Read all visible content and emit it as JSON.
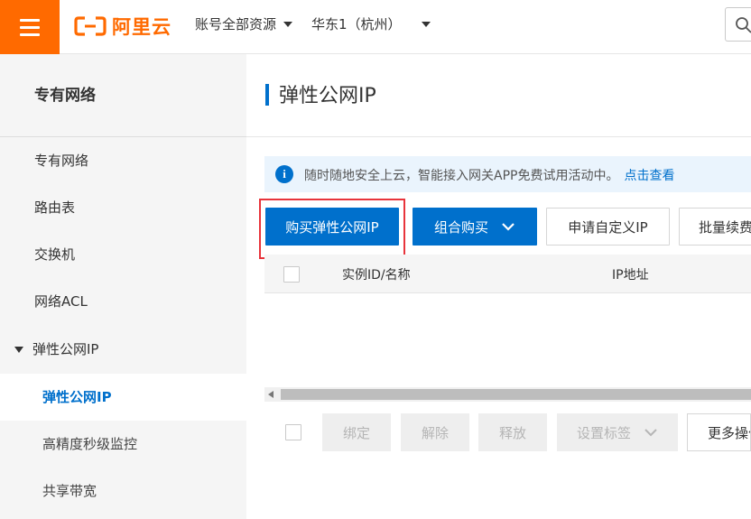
{
  "header": {
    "logo_text": "阿里云",
    "account_dropdown": "账号全部资源",
    "region_dropdown": "华东1（杭州）"
  },
  "sidebar": {
    "title": "专有网络",
    "items": [
      {
        "label": "专有网络"
      },
      {
        "label": "路由表"
      },
      {
        "label": "交换机"
      },
      {
        "label": "网络ACL"
      },
      {
        "label": "弹性公网IP"
      },
      {
        "label": "弹性公网IP"
      },
      {
        "label": "高精度秒级监控"
      },
      {
        "label": "共享带宽"
      }
    ]
  },
  "main": {
    "page_title": "弹性公网IP",
    "notice": {
      "text": "随时随地安全上云，智能接入网关APP免费试用活动中。",
      "link": "点击查看"
    },
    "toolbar": {
      "buy_eip": "购买弹性公网IP",
      "combo_buy": "组合购买",
      "apply_custom_ip": "申请自定义IP",
      "batch_renew": "批量续费"
    },
    "table": {
      "columns": [
        "实例ID/名称",
        "IP地址"
      ]
    },
    "bottom_actions": {
      "bind": "绑定",
      "unbind": "解除",
      "release": "释放",
      "set_tags": "设置标签",
      "more": "更多操作"
    }
  },
  "colors": {
    "brand_orange": "#ff6a00",
    "primary_blue": "#0070cc",
    "highlight_red": "#e8343b"
  }
}
